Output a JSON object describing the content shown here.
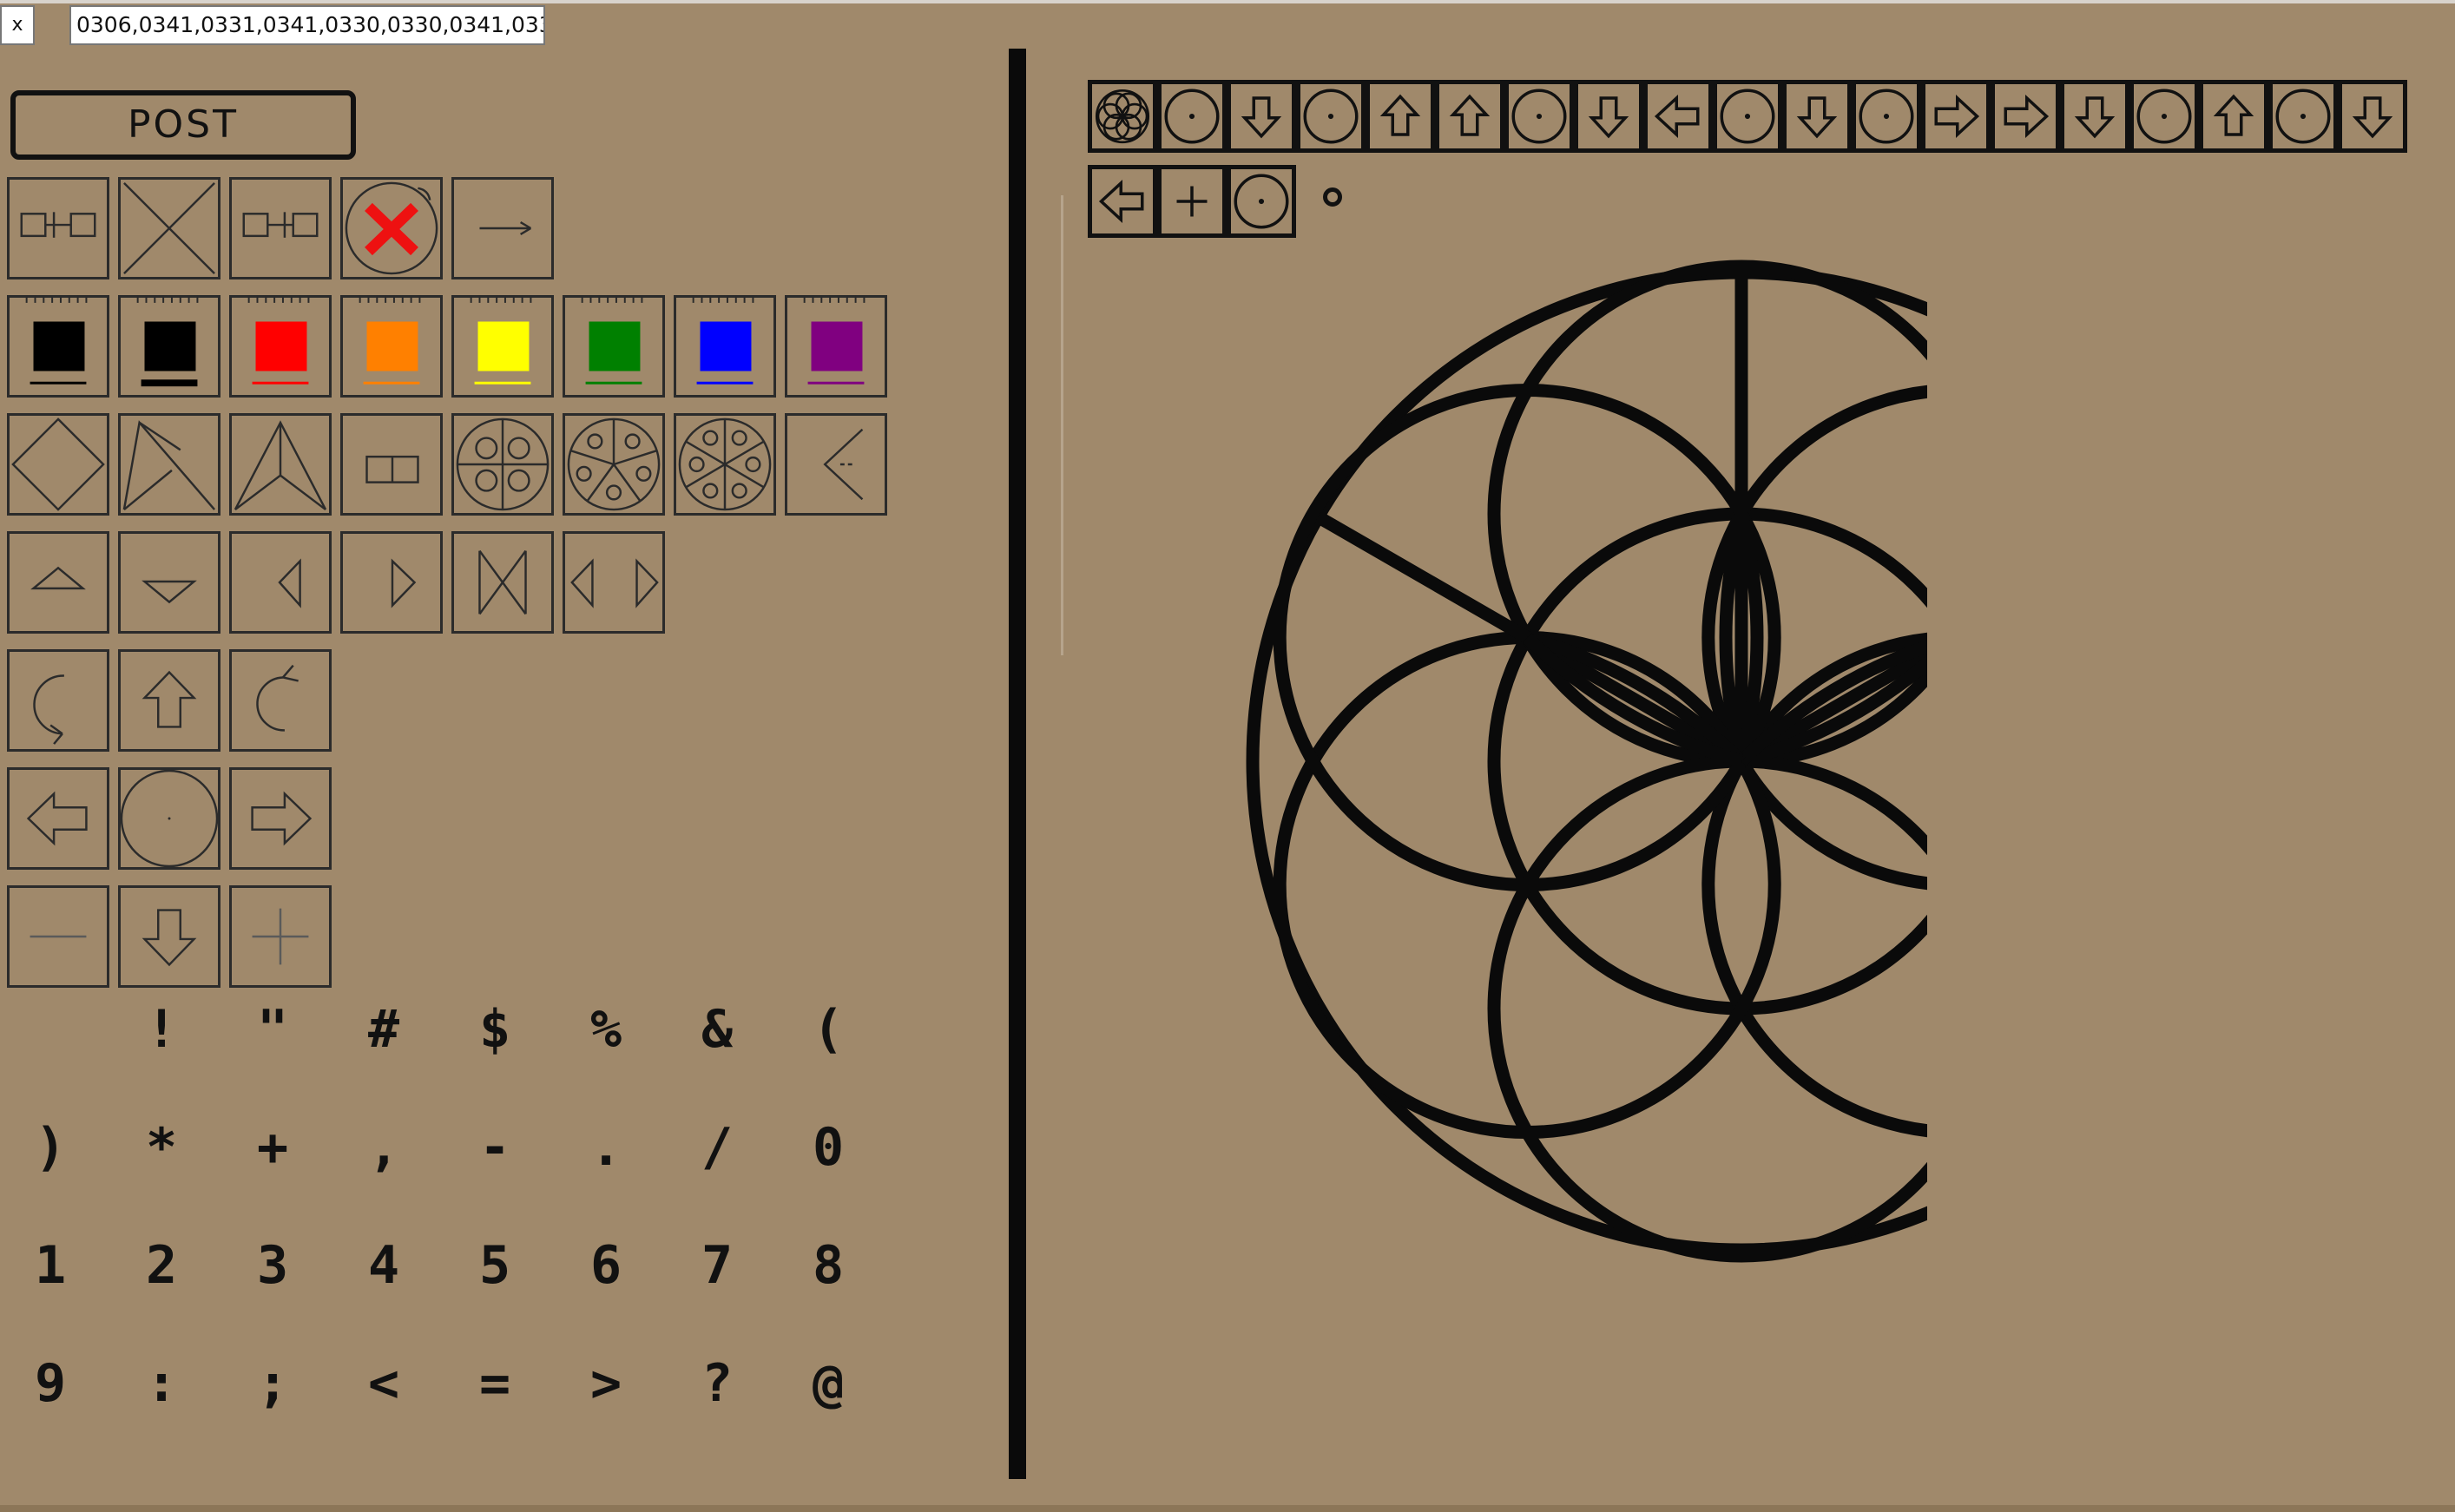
{
  "window": {
    "close_label": "x"
  },
  "address": {
    "value": "0306,0341,0331,0341,0330,0330,0341,033"
  },
  "post_button": {
    "label": "POST"
  },
  "symbols": [
    "!",
    "\"",
    "#",
    "$",
    "%",
    "&",
    "(",
    ")",
    "*",
    "+",
    ",",
    "-",
    ".",
    "/",
    "0",
    "1",
    "2",
    "3",
    "4",
    "5",
    "6",
    "7",
    "8",
    "9",
    ":",
    ";",
    "<",
    "=",
    ">",
    "?",
    "@"
  ],
  "colors": {
    "background": "#a0896b",
    "swatches": [
      "#000000",
      "#000000",
      "#ff0000",
      "#ff8000",
      "#ffff00",
      "#008000",
      "#0000ff",
      "#800080"
    ]
  },
  "tools": {
    "row1": [
      "split-left-icon",
      "clear-icon",
      "split-right-icon",
      "delete-icon",
      "arrow-right-icon"
    ],
    "row2": [
      "black-thin-icon",
      "black-thick-icon",
      "red-icon",
      "orange-icon",
      "yellow-icon",
      "green-icon",
      "blue-icon",
      "purple-icon"
    ],
    "row3": [
      "diamond-icon",
      "kite-icon",
      "triangle-icon",
      "rect-icon",
      "four-circles-icon",
      "five-circles-icon",
      "six-circles-icon",
      "angle-icon"
    ],
    "row4": [
      "triangle-up-icon",
      "triangle-down-icon",
      "triangle-left-icon",
      "triangle-right-icon",
      "bowtie-icon",
      "double-triangle-icon"
    ],
    "row5": [
      "rotate-ccw-icon",
      "arrow-up-icon",
      "rotate-cw-icon"
    ],
    "row6": [
      "arrow-left-icon",
      "center-circle-icon",
      "arrow-right-outline-icon"
    ],
    "row7": [
      "minus-icon",
      "arrow-down-icon",
      "plus-icon"
    ]
  },
  "sequence": {
    "row1": [
      "flower",
      "dot",
      "down",
      "dot",
      "up",
      "up",
      "dot",
      "down",
      "left",
      "dot",
      "down",
      "dot",
      "right",
      "right",
      "down",
      "dot",
      "up",
      "dot",
      "down"
    ],
    "row2": [
      "left",
      "plus",
      "dot"
    ]
  }
}
